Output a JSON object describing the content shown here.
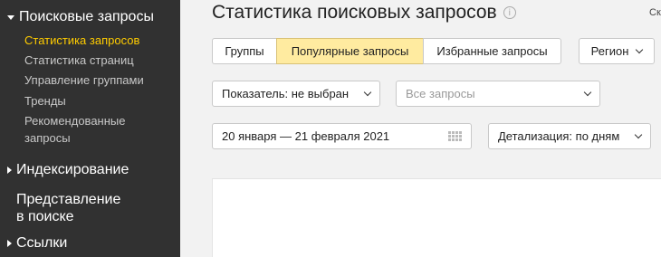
{
  "sidebar": {
    "section_search": "Поисковые запросы",
    "items": [
      "Статистика запросов",
      "Статистика страниц",
      "Управление группами",
      "Тренды",
      "Рекомендованные",
      "запросы"
    ],
    "section_indexing": "Индексирование",
    "representation_line1": "Представление",
    "representation_line2": "в поиске",
    "section_links": "Ссылки"
  },
  "header": {
    "title": "Статистика поисковых запросов",
    "corner_text": "Ск"
  },
  "tabs": {
    "groups": "Группы",
    "popular": "Популярные запросы",
    "favorites": "Избранные запросы",
    "active": "popular"
  },
  "region_label": "Регион",
  "filters": {
    "indicator": "Показатель: не выбран",
    "queries_placeholder": "Все запросы",
    "date_range": "20 января — 21 февраля 2021",
    "detail": "Детализация: по дням"
  },
  "colors": {
    "sidebar_bg": "#313131",
    "active_nav": "#ffcc00",
    "selected_tab": "#ffeba0"
  },
  "icons": [
    "triangle-down-icon",
    "triangle-right-icon",
    "info-icon",
    "chevron-down-icon",
    "calendar-icon"
  ]
}
